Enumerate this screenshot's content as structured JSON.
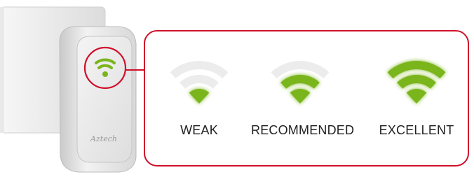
{
  "device": {
    "brand": "Aztech"
  },
  "signal_levels": [
    {
      "label": "WEAK",
      "lit_bars": 1
    },
    {
      "label": "RECOMMENDED",
      "lit_bars": 2
    },
    {
      "label": "EXCELLENT",
      "lit_bars": 3
    }
  ],
  "colors": {
    "signal_green": "#7ab51d",
    "highlight_red": "#d0102b",
    "unlit_bar": "#ececec"
  }
}
